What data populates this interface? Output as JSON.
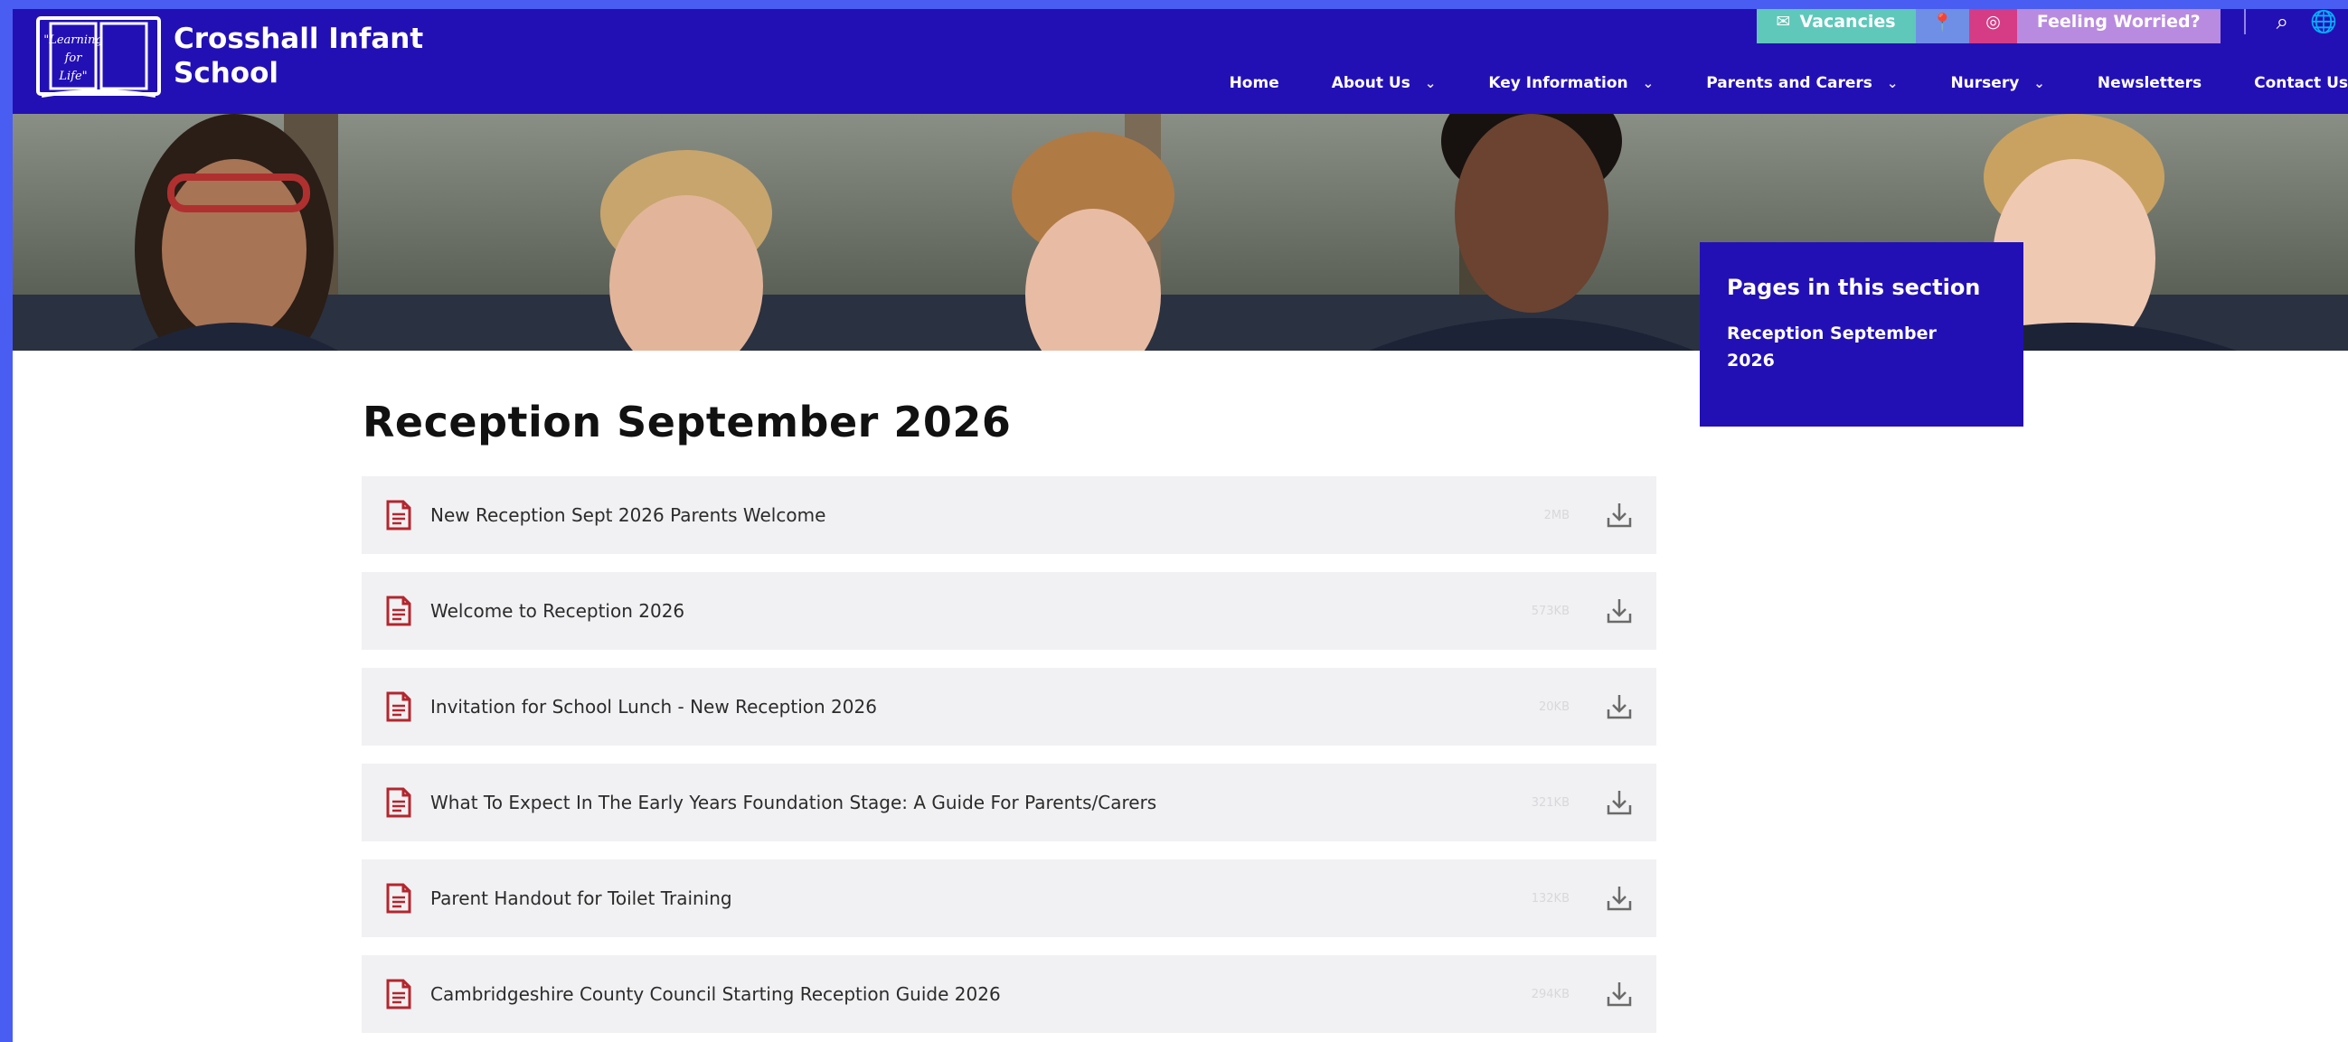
{
  "school": {
    "name": "Crosshall Infant School",
    "motto": "Learning for Life"
  },
  "utility": {
    "vacancies_label": "Vacancies",
    "worried_label": "Feeling Worried?",
    "icons": [
      "envelope-icon",
      "map-pin-icon",
      "instagram-icon",
      "search-icon",
      "globe-icon"
    ]
  },
  "nav": {
    "items": [
      {
        "label": "Home",
        "dropdown": false
      },
      {
        "label": "About Us",
        "dropdown": true
      },
      {
        "label": "Key Information",
        "dropdown": true
      },
      {
        "label": "Parents and Carers",
        "dropdown": true
      },
      {
        "label": "Nursery",
        "dropdown": true
      },
      {
        "label": "Newsletters",
        "dropdown": false
      },
      {
        "label": "Contact Us",
        "dropdown": false
      }
    ]
  },
  "section_nav": {
    "heading": "Pages in this section",
    "links": [
      "Reception September 2026"
    ]
  },
  "page": {
    "title": "Reception September 2026"
  },
  "files": [
    {
      "name": "New Reception Sept 2026 Parents Welcome",
      "size": "2MB"
    },
    {
      "name": "Welcome to Reception 2026",
      "size": "573KB"
    },
    {
      "name": "Invitation for School Lunch - New Reception 2026",
      "size": "20KB"
    },
    {
      "name": "What To Expect In The Early Years Foundation Stage: A Guide For Parents/Carers",
      "size": "321KB"
    },
    {
      "name": "Parent Handout for Toilet Training",
      "size": "132KB"
    },
    {
      "name": "Cambridgeshire County Council Starting Reception Guide 2026",
      "size": "294KB"
    }
  ],
  "colors": {
    "brand_navy": "#2310b5",
    "frame_blue": "#4a5df2",
    "vacancies_teal": "#5fc8ba",
    "instagram_pink": "#d63b86",
    "worried_lilac": "#b88be0",
    "file_icon_red": "#b3262e"
  }
}
